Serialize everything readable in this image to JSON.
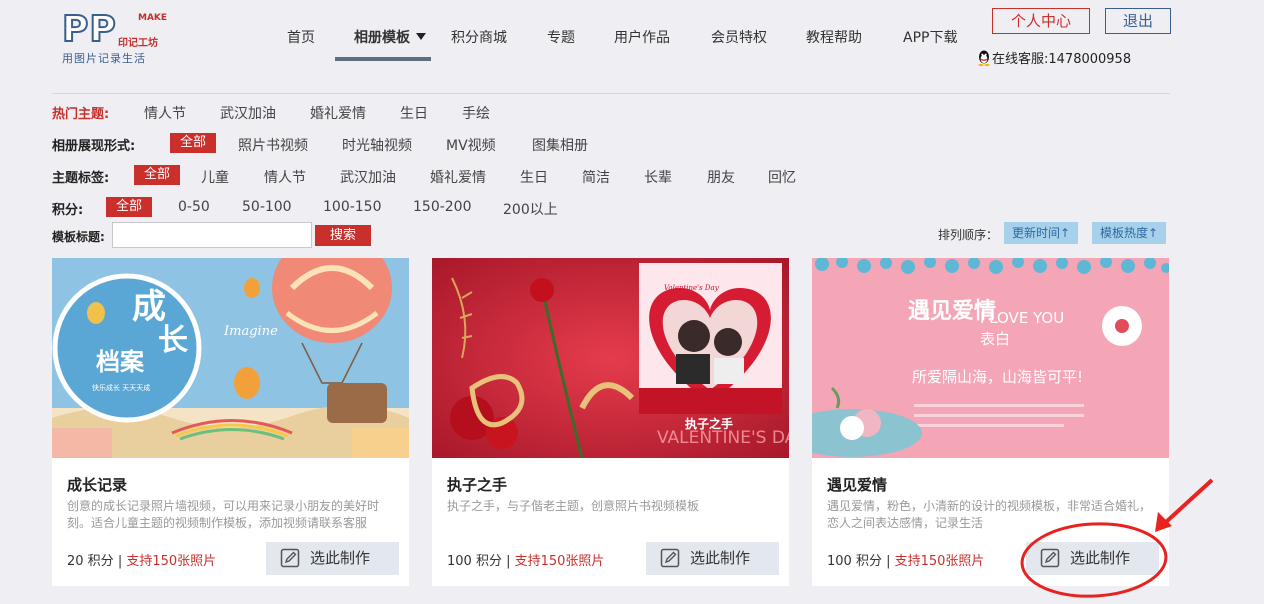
{
  "logo": {
    "mark": "PP",
    "make": "MAKE",
    "brand": "印记工坊",
    "slogan": "用图片记录生活"
  },
  "nav": {
    "items": [
      {
        "label": "首页"
      },
      {
        "label": "相册模板"
      },
      {
        "label": "积分商城"
      },
      {
        "label": "专题"
      },
      {
        "label": "用户作品"
      },
      {
        "label": "会员特权"
      },
      {
        "label": "教程帮助"
      },
      {
        "label": "APP下载"
      }
    ],
    "active_index": 1
  },
  "header": {
    "personal_center": "个人中心",
    "logout": "退出",
    "service": "在线客服:1478000958"
  },
  "filters": {
    "hot": {
      "label": "热门主题:",
      "options": [
        "情人节",
        "武汉加油",
        "婚礼爱情",
        "生日",
        "手绘"
      ]
    },
    "form": {
      "label": "相册展现形式:",
      "options": [
        "全部",
        "照片书视频",
        "时光轴视频",
        "MV视频",
        "图集相册"
      ],
      "selected": "全部"
    },
    "tags": {
      "label": "主题标签:",
      "options": [
        "全部",
        "儿童",
        "情人节",
        "武汉加油",
        "婚礼爱情",
        "生日",
        "简洁",
        "长辈",
        "朋友",
        "回忆"
      ],
      "selected": "全部"
    },
    "points": {
      "label": "积分:",
      "options": [
        "全部",
        "0-50",
        "50-100",
        "100-150",
        "150-200",
        "200以上"
      ],
      "selected": "全部"
    }
  },
  "search": {
    "label": "模板标题:",
    "value": "",
    "button": "搜索"
  },
  "sort": {
    "label": "排列顺序：",
    "by_time": "更新时间↑",
    "by_hot": "模板热度↑"
  },
  "cards": [
    {
      "title": "成长记录",
      "desc": "创意的成长记录照片墙视频，可以用来记录小朋友的美好时刻。适合儿童主题的视频制作模板，添加视频请联系客服",
      "points": "20 积分",
      "separator": " | ",
      "support": "支持150张照片",
      "button": "选此制作",
      "image_text": {
        "title_a": "成",
        "title_b": "长",
        "title_c": "档案",
        "en": "Imagine",
        "stamp": "快乐成长 天天天成"
      }
    },
    {
      "title": "执子之手",
      "desc": "执子之手，与子偕老主题，创意照片书视频模板",
      "points": "100 积分",
      "separator": " | ",
      "support": "支持150张照片",
      "button": "选此制作",
      "image_text": {
        "ribbon": "执子之手",
        "valentine": "Valentine's Day",
        "bg": "VALENTINE'S DAY"
      }
    },
    {
      "title": "遇见爱情",
      "desc": "遇见爱情，粉色，小清新的设计的视频模板，非常适合婚礼，恋人之间表达感情，记录生活",
      "points": "100 积分",
      "separator": " | ",
      "support": "支持150张照片",
      "button": "选此制作",
      "image_text": {
        "title": "遇见爱情",
        "en": "I LOVE YOU",
        "cn": "表白",
        "line": "所爱隔山海，山海皆可平!"
      }
    }
  ],
  "colors": {
    "accent_red": "#c9302c",
    "brand_blue": "#3a5f8f",
    "background": "#eeeef3",
    "sort_button": "#a7d0eb"
  }
}
